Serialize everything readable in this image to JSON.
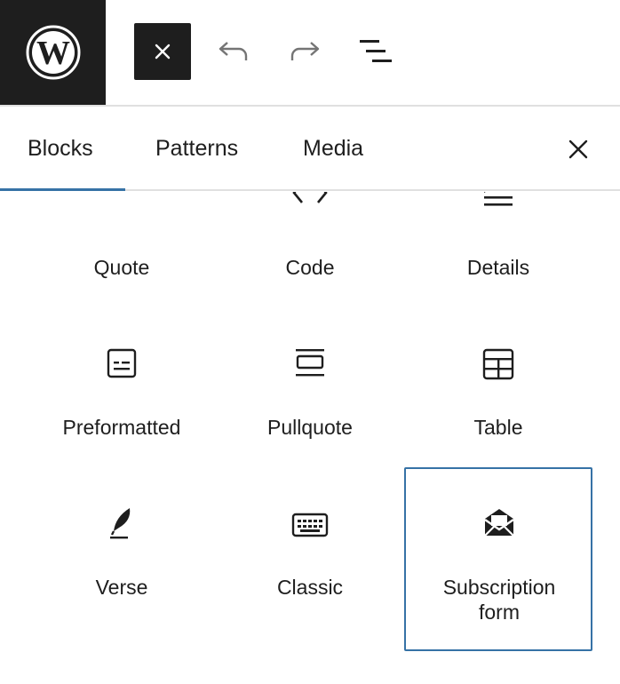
{
  "toolbar": {
    "logo_icon": "wordpress-logo-icon",
    "close_icon": "close-icon",
    "undo_icon": "undo-icon",
    "redo_icon": "redo-icon",
    "list_view_icon": "list-view-icon"
  },
  "tabs": [
    {
      "label": "Blocks",
      "active": true
    },
    {
      "label": "Patterns",
      "active": false
    },
    {
      "label": "Media",
      "active": false
    }
  ],
  "panel_close_icon": "close-icon",
  "blocks": [
    {
      "label": "Quote",
      "icon": "quote-icon"
    },
    {
      "label": "Code",
      "icon": "code-icon"
    },
    {
      "label": "Details",
      "icon": "details-icon"
    },
    {
      "label": "Preformatted",
      "icon": "preformatted-icon"
    },
    {
      "label": "Pullquote",
      "icon": "pullquote-icon"
    },
    {
      "label": "Table",
      "icon": "table-icon"
    },
    {
      "label": "Verse",
      "icon": "verse-icon"
    },
    {
      "label": "Classic",
      "icon": "keyboard-icon"
    },
    {
      "label": "Subscription form",
      "label_line1": "Subscription",
      "label_line2": "form",
      "icon": "envelope-icon",
      "selected": true
    }
  ],
  "colors": {
    "dark": "#1e1e1e",
    "accent": "#3672a6",
    "border": "#e0e0e0",
    "muted_icon": "#757575"
  }
}
